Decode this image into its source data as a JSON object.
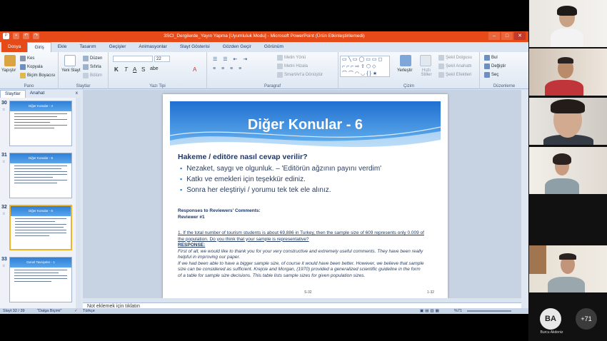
{
  "window": {
    "title": "3SCI_Dergilerde_Yayın Yapma [Uyumluluk Modu] - Microsoft PowerPoint (Ürün Etkinleştirilemedi)"
  },
  "tabs": [
    "Dosya",
    "Giriş",
    "Ekle",
    "Tasarım",
    "Geçişler",
    "Animasyonlar",
    "Slayt Gösterisi",
    "Gözden Geçir",
    "Görünüm"
  ],
  "ribbon": {
    "pano": {
      "label": "Pano",
      "paste": "Yapıştır",
      "cut": "Kes",
      "copy": "Kopyala",
      "format_painter": "Biçim Boyacısı"
    },
    "slaytlar": {
      "label": "Slaytlar",
      "new_slide": "Yeni Slayt",
      "layout": "Düzen",
      "reset": "Sıfırla",
      "section": "Bölüm"
    },
    "yazi_tipi": {
      "label": "Yazı Tipi",
      "font_size": "22",
      "bold": "K",
      "italic": "T",
      "underline": "A",
      "strike": "S",
      "shadow": "abe",
      "font_color": "A"
    },
    "paragraf": {
      "label": "Paragraf",
      "text_direction": "Metin Yönü",
      "align_text": "Metni Hizala",
      "smartart": "SmartArt'a Dönüştür"
    },
    "cizim": {
      "label": "Çizim",
      "arrange": "Yerleştir",
      "quick_styles": "Hızlı Stiller",
      "shape_fill": "Şekil Dolgusu",
      "shape_outline": "Şekil Anahattı",
      "shape_effects": "Şekil Efektleri"
    },
    "duzenleme": {
      "label": "Düzenleme",
      "find": "Bul",
      "replace": "Değiştir",
      "select": "Seç"
    }
  },
  "left_pane": {
    "tab_slides": "Slaytlar",
    "tab_outline": "Anahat",
    "close": "x",
    "thumbnails": [
      {
        "number": "30",
        "title": "Diğer Konular - 4"
      },
      {
        "number": "31",
        "title": "Diğer Konular - 5"
      },
      {
        "number": "32",
        "title": "Diğer Konular - 6"
      },
      {
        "number": "33",
        "title": "Genel Tavsiyeler - 1"
      }
    ]
  },
  "slide": {
    "title": "Diğer Konular - 6",
    "heading": "Hakeme / editöre nasıl cevap verilir?",
    "bullets": [
      "Nezaket, saygı ve olgunluk. – 'Editörün ağzının payını verdim'",
      "Katkı ve emekleri için teşekkür ediniz.",
      "Sonra her eleştiriyi / yorumu tek tek ele alınız."
    ],
    "responses_header": "Responses to Reviewers' Comments:",
    "reviewer_label": "Reviewer #1",
    "question": "1. If the total number of tourism students is about 69,886 in Turkey, then the sample size of 609 represents only 0.009 of the population.  Do you think that your sample is representative?",
    "response_label": "RESPONSE:",
    "response_lines": [
      "First of all, we would like to thank you for your very constructive and extremely useful comments. They have been really helpful in improving our paper.",
      "If we had been able to have a bigger sample size, of course it would have been better. However, we believe that sample size can be considered as sufficient. Krejcie and Morgan, (1970) provided a generalized scientific guideline in the form of a table for sample size decisions. This table lists sample sizes for given population sizes."
    ],
    "footer_left": "S-32",
    "footer_right": "1-32"
  },
  "notes_placeholder": "Not eklemek için tıklatın",
  "status": {
    "slide_info": "Slayt 32 / 39",
    "theme": "\"Dalga Biçimi\"",
    "language": "Türkçe",
    "zoom": "%71"
  },
  "participants": {
    "avatar_initials": "BA",
    "avatar_name": "Burcu Akdeniz",
    "more_count": "+71"
  },
  "colors": {
    "title_bar": "#e64a19",
    "slide_banner": "#2f7fd6",
    "heading_text": "#1f3864"
  }
}
